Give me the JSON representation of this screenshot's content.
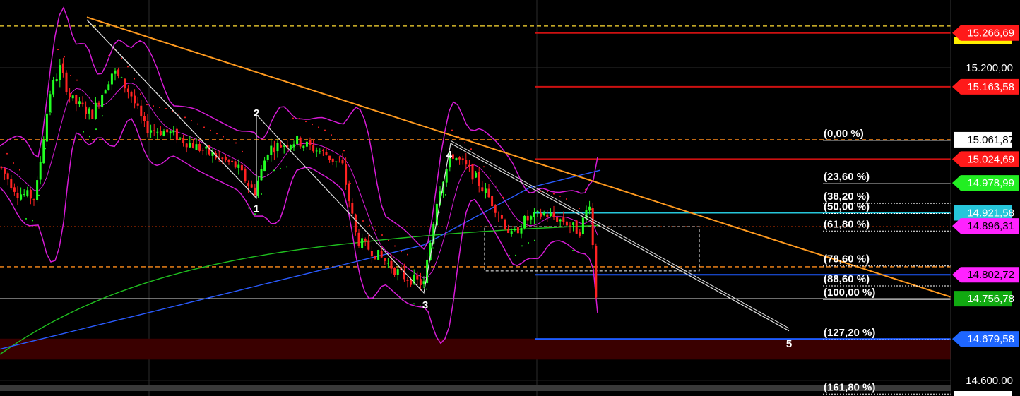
{
  "chart_data": {
    "type": "candlestick",
    "ylim": [
      14570,
      15330
    ],
    "y_axis_ticks": [
      {
        "value": 15200.0,
        "label": "15.200,00"
      },
      {
        "value": 14600.0,
        "label": "14.600,00"
      }
    ],
    "price_tags": [
      {
        "value": 15266.69,
        "label": "15.266,69",
        "bg": "#ff1a1a",
        "fg": "#ffffff",
        "shape": "arrow"
      },
      {
        "value": 15163.58,
        "label": "15.163,58",
        "bg": "#ff1a1a",
        "fg": "#ffffff",
        "shape": "arrow"
      },
      {
        "value": 15061.87,
        "label": "15.061,87",
        "bg": "#ffffff",
        "fg": "#000000",
        "shape": "box"
      },
      {
        "value": 15024.69,
        "label": "15.024,69",
        "bg": "#ff1a1a",
        "fg": "#ffffff",
        "shape": "arrow"
      },
      {
        "value": 14978.99,
        "label": "14.978,99",
        "bg": "#22ee22",
        "fg": "#ffffff",
        "shape": "arrow"
      },
      {
        "value": 14921.58,
        "label": "14.921,58",
        "bg": "#26c6da",
        "fg": "#ffffff",
        "shape": "box"
      },
      {
        "value": 14896.31,
        "label": "14.896,31",
        "bg": "#ff22ff",
        "fg": "#000000",
        "shape": "arrow"
      },
      {
        "value": 14802.72,
        "label": "14.802,72",
        "bg": "#ff22ff",
        "fg": "#000000",
        "shape": "arrow"
      },
      {
        "value": 14756.78,
        "label": "14.756,78",
        "bg": "#11aa11",
        "fg": "#ffffff",
        "shape": "box"
      },
      {
        "value": 14679.58,
        "label": "14.679,58",
        "bg": "#1e66ff",
        "fg": "#ffffff",
        "shape": "arrow"
      }
    ],
    "fibonacci_levels": [
      {
        "label": "(0,00 %)",
        "value": 15061.87
      },
      {
        "label": "(23,60 %)",
        "value": 14978.99
      },
      {
        "label": "(38,20 %)",
        "value": 14941.0
      },
      {
        "label": "(50,00 %)",
        "value": 14921.58
      },
      {
        "label": "(61,80 %)",
        "value": 14887.97
      },
      {
        "label": "(78,60 %)",
        "value": 14821.0
      },
      {
        "label": "(88,60 %)",
        "value": 14782.69
      },
      {
        "label": "(100,00 %)",
        "value": 14756.78
      },
      {
        "label": "(127,20 %)",
        "value": 14679.58
      },
      {
        "label": "(161,80 %)",
        "value": 14575.0
      }
    ],
    "horizontal_levels": [
      {
        "value": 15266.69,
        "color": "#cc1111",
        "style": "solid"
      },
      {
        "value": 15163.58,
        "color": "#cc1111",
        "style": "solid"
      },
      {
        "value": 15024.69,
        "color": "#cc1111",
        "style": "solid"
      },
      {
        "value": 14921.58,
        "color": "#26c6da",
        "style": "solid"
      },
      {
        "value": 14802.72,
        "color": "#1e5bff",
        "style": "solid"
      },
      {
        "value": 14679.58,
        "color": "#1e5bff",
        "style": "solid"
      },
      {
        "value": 15280.0,
        "color": "#ffdd33",
        "style": "dashed"
      },
      {
        "value": 15061.87,
        "color": "#ff8c1a",
        "style": "dashed"
      },
      {
        "value": 14818.0,
        "color": "#ff8c1a",
        "style": "dashed"
      },
      {
        "value": 14895.0,
        "color": "#cc3300",
        "style": "dotted"
      },
      {
        "value": 14756.78,
        "color": "#dddddd",
        "style": "solid"
      }
    ],
    "wave_labels": [
      {
        "label": "1",
        "value": 14934
      },
      {
        "label": "2",
        "value": 15101
      },
      {
        "label": "3",
        "value": 14749
      },
      {
        "label": "4",
        "value": 15043
      },
      {
        "label": "5",
        "value": 14674
      }
    ],
    "background_colors": {
      "plot": "#000000",
      "resistance_band": "#3a0000",
      "grid": "#333333"
    }
  }
}
